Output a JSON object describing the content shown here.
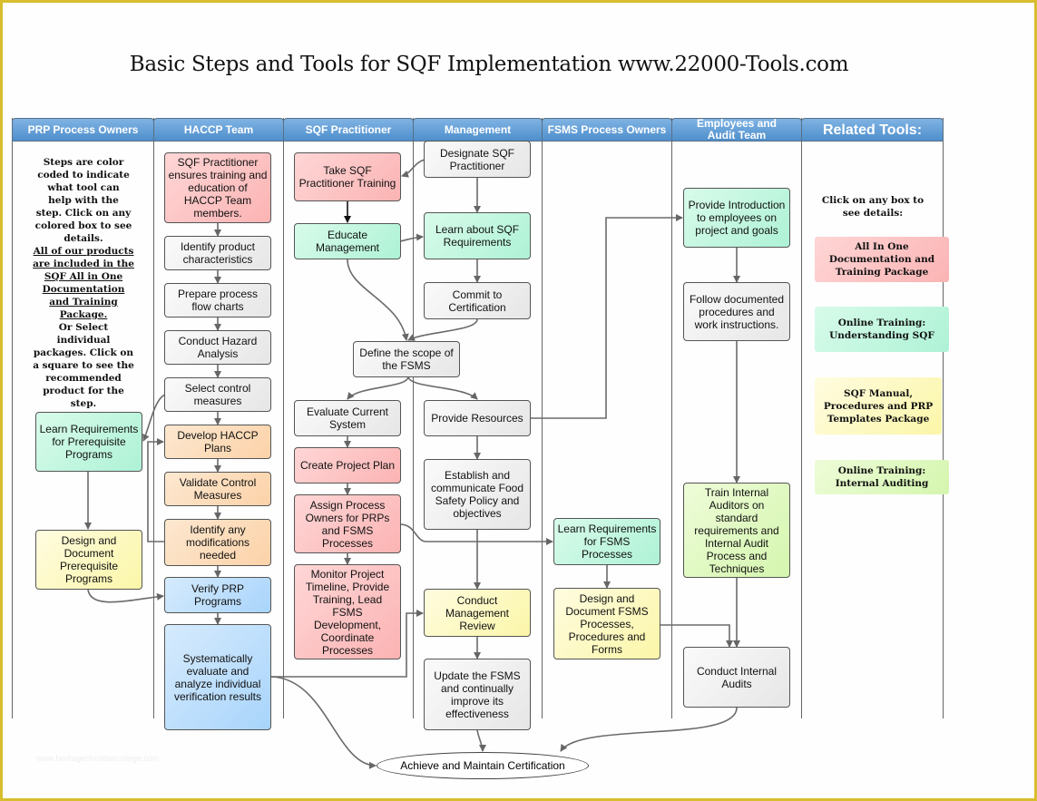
{
  "title": "Basic Steps and Tools for SQF Implementation www.22000-Tools.com",
  "lanes": [
    {
      "label": "PRP Process Owners"
    },
    {
      "label": "HACCP Team"
    },
    {
      "label": "SQF Practitioner"
    },
    {
      "label": "Management"
    },
    {
      "label": "FSMS Process Owners"
    },
    {
      "label": "Employees and Audit Team"
    },
    {
      "label": "Related Tools:"
    }
  ],
  "notes": {
    "color_coding": "Steps are color coded to indicate what tool can help with the step. Click on any colored box to see details.",
    "all_products": "All of our products are included in the SQF All in One Documentation and Training Package.",
    "select_individual": "Or Select individual packages. Click on a square to see the recommended product for the step.",
    "tools_hint": "Click on any box to see details:"
  },
  "legend_colors": {
    "all_in_one": "#fbb3b3",
    "understanding_sqf": "#aef2d6",
    "manual_templates": "#fbf6a8",
    "internal_auditing": "#d4f6ae"
  },
  "tools": [
    {
      "label": "All In One Documentation and Training Package"
    },
    {
      "label": "Online Training: Understanding SQF"
    },
    {
      "label": "SQF Manual, Procedures and PRP Templates Package"
    },
    {
      "label": "Online Training: Internal Auditing"
    }
  ],
  "steps": {
    "prp_learn": "Learn Requirements for Prerequisite Programs",
    "prp_design": "Design and Document Prerequisite Programs",
    "haccp_training": "SQF Practitioner ensures training and education of HACCP Team members.",
    "haccp_identify": "Identify product characteristics",
    "haccp_flow": "Prepare process flow charts",
    "haccp_hazard": "Conduct Hazard Analysis",
    "haccp_select": "Select control measures",
    "haccp_develop": "Develop HACCP Plans",
    "haccp_validate": "Validate Control Measures",
    "haccp_modify": "Identify any modifications needed",
    "haccp_verify": "Verify PRP Programs",
    "haccp_evaluate": "Systematically evaluate and analyze individual verification results",
    "sqf_training": "Take SQF Practitioner Training",
    "sqf_educate": "Educate Management",
    "sqf_scope": "Define the scope of the FSMS",
    "sqf_evaluate": "Evaluate Current System",
    "sqf_plan": "Create Project Plan",
    "sqf_assign": "Assign Process Owners for PRPs and FSMS Processes",
    "sqf_monitor": "Monitor Project Timeline, Provide Training, Lead FSMS Development, Coordinate Processes",
    "mgmt_designate": "Designate SQF Practitioner",
    "mgmt_learn": "Learn about SQF Requirements",
    "mgmt_commit": "Commit to Certification",
    "mgmt_resources": "Provide Resources",
    "mgmt_policy": "Establish and communicate Food Safety Policy and objectives",
    "mgmt_review": "Conduct Management Review",
    "mgmt_update": "Update the FSMS and continually improve its effectiveness",
    "fsms_learn": "Learn Requirements for FSMS Processes",
    "fsms_design": "Design and Document FSMS Processes, Procedures and Forms",
    "emp_intro": "Provide Introduction to employees on project and goals",
    "emp_follow": "Follow documented procedures and work instructions.",
    "emp_train": "Train Internal Auditors on standard requirements and Internal Audit Process and Techniques",
    "emp_audit": "Conduct Internal Audits",
    "final": "Achieve and Maintain Certification"
  },
  "watermark": "www.heritagechristiancollege.com"
}
